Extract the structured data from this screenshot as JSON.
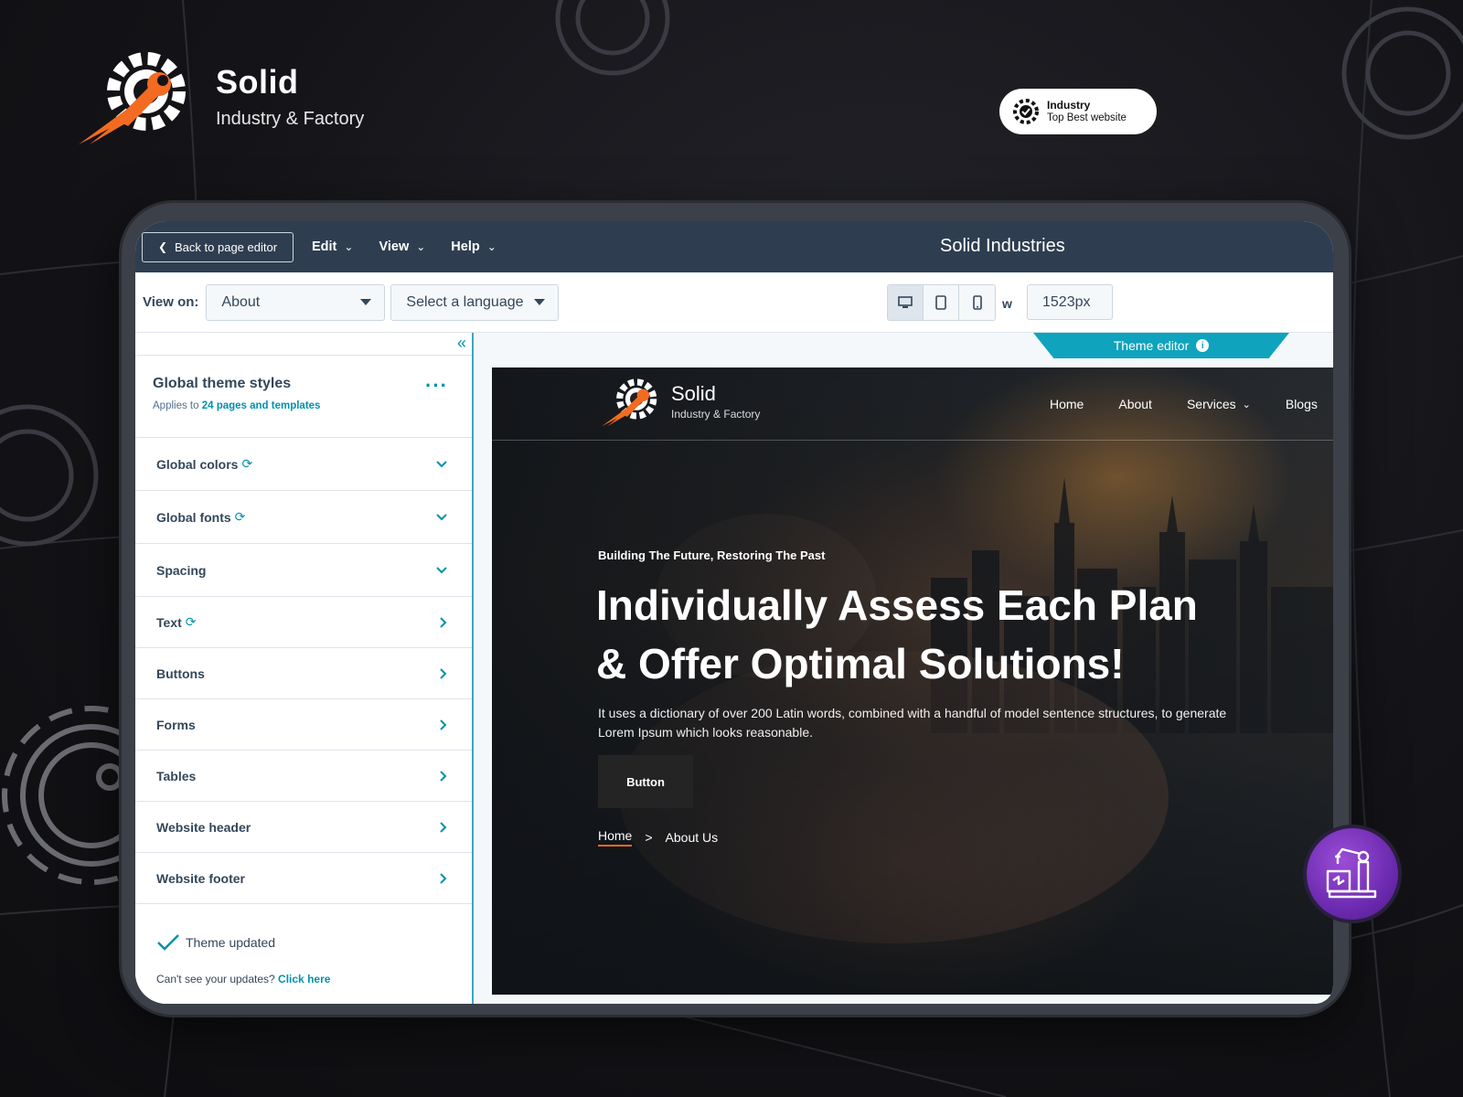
{
  "brand": {
    "name": "Solid",
    "subtitle": "Industry & Factory"
  },
  "badge": {
    "line1": "Industry",
    "line2": "Top Best website"
  },
  "editor": {
    "back_label": "Back to page editor",
    "menu": [
      {
        "label": "Edit"
      },
      {
        "label": "View"
      },
      {
        "label": "Help"
      }
    ],
    "title": "Solid Industries",
    "view_on_label": "View on:",
    "page_select": "About",
    "language_select": "Select a language",
    "width_label": "w",
    "width_value": "1523px"
  },
  "panel": {
    "title": "Global theme styles",
    "applies_prefix": "Applies to ",
    "applies_link": "24 pages and templates",
    "items": [
      {
        "label": "Global colors",
        "sync": true,
        "type": "expand"
      },
      {
        "label": "Global fonts",
        "sync": true,
        "type": "expand"
      },
      {
        "label": "Spacing",
        "sync": false,
        "type": "expand"
      },
      {
        "label": "Text",
        "sync": true,
        "type": "nav"
      },
      {
        "label": "Buttons",
        "sync": false,
        "type": "nav"
      },
      {
        "label": "Forms",
        "sync": false,
        "type": "nav"
      },
      {
        "label": "Tables",
        "sync": false,
        "type": "nav"
      },
      {
        "label": "Website header",
        "sync": false,
        "type": "nav"
      },
      {
        "label": "Website footer",
        "sync": false,
        "type": "nav"
      }
    ],
    "status": "Theme updated",
    "cant_see_prefix": "Can't see your updates? ",
    "cant_see_link": "Click here"
  },
  "preview": {
    "theme_tab": "Theme editor",
    "site": {
      "logo_name": "Solid",
      "logo_sub": "Industry & Factory",
      "nav": [
        {
          "label": "Home",
          "dropdown": false
        },
        {
          "label": "About",
          "dropdown": false
        },
        {
          "label": "Services",
          "dropdown": true
        },
        {
          "label": "Blogs",
          "dropdown": false
        }
      ],
      "kicker": "Building The Future, Restoring The Past",
      "headline_line1": "Individually Assess Each Plan",
      "headline_line2": "& Offer Optimal Solutions!",
      "description": "It uses a dictionary of over 200 Latin words, combined with a handful of model sentence structures, to generate Lorem Ipsum which looks reasonable.",
      "button": "Button",
      "crumb_home": "Home",
      "crumb_sep": ">",
      "crumb_current": "About Us"
    }
  },
  "colors": {
    "accent_orange": "#f26b21",
    "editor_dark": "#2e3e50",
    "teal": "#0fa3bd",
    "purple": "#6c2bb0"
  }
}
